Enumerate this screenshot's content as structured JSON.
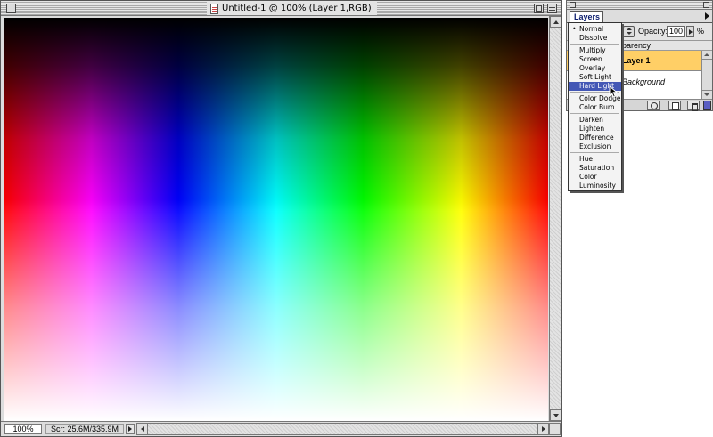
{
  "document": {
    "title": "Untitled-1 @ 100% (Layer 1,RGB)",
    "zoom": "100%",
    "scratch": "Scr: 25.6M/335.9M"
  },
  "layers_palette": {
    "tab_label": "Layers",
    "opacity_label": "Opacity:",
    "opacity_value": "100",
    "opacity_unit": "%",
    "preserve_label": "parency",
    "layers": [
      {
        "name": "Layer 1",
        "selected": true
      },
      {
        "name": "Background",
        "selected": false
      }
    ]
  },
  "blend_menu": {
    "current": "Normal",
    "highlighted": "Hard Light",
    "items": [
      {
        "label": "Normal",
        "checked": true
      },
      {
        "label": "Dissolve"
      },
      {
        "label": "Multiply"
      },
      {
        "label": "Screen"
      },
      {
        "label": "Overlay"
      },
      {
        "label": "Soft Light"
      },
      {
        "label": "Hard Light",
        "highlighted": true
      },
      {
        "label": "Color Dodge"
      },
      {
        "label": "Color Burn"
      },
      {
        "label": "Darken"
      },
      {
        "label": "Lighten"
      },
      {
        "label": "Difference"
      },
      {
        "label": "Exclusion"
      },
      {
        "label": "Hue"
      },
      {
        "label": "Saturation"
      },
      {
        "label": "Color"
      },
      {
        "label": "Luminosity"
      }
    ]
  },
  "colors": {
    "selected_layer": "#ffcf66",
    "menu_highlight": "#4357b5"
  },
  "icons": {
    "doc_title": "document-icon",
    "cursor": "arrow-cursor-icon"
  }
}
